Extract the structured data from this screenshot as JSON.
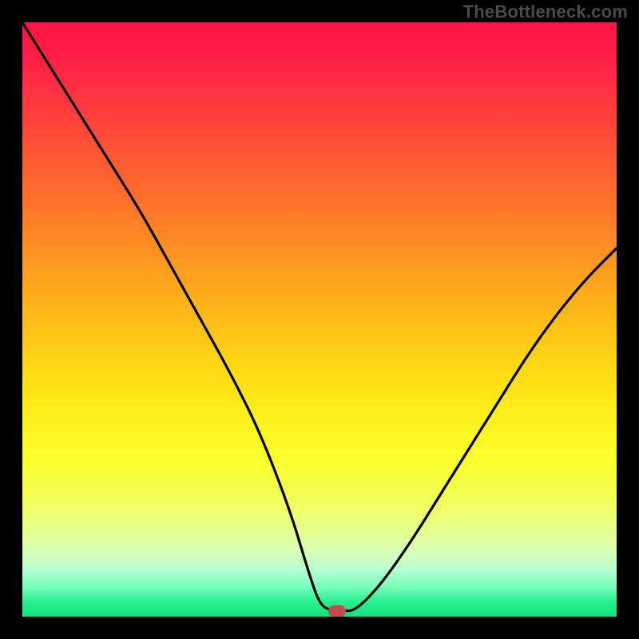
{
  "watermark": "TheBottleneck.com",
  "chart_data": {
    "type": "line",
    "title": "",
    "xlabel": "",
    "ylabel": "",
    "xlim": [
      0,
      100
    ],
    "ylim": [
      0,
      100
    ],
    "grid": false,
    "legend": false,
    "background": "rainbow-vertical-gradient",
    "series": [
      {
        "name": "bottleneck-curve",
        "x": [
          0,
          5,
          10,
          15,
          20,
          25,
          30,
          35,
          40,
          45,
          48,
          50,
          52,
          54,
          56,
          60,
          65,
          70,
          75,
          80,
          85,
          90,
          95,
          100
        ],
        "y": [
          100,
          92,
          84,
          76,
          68,
          59,
          50,
          41,
          31,
          18,
          8,
          2,
          1,
          1,
          1,
          5,
          12,
          20,
          28,
          36,
          44,
          51,
          57,
          62
        ]
      }
    ],
    "marker": {
      "x": 53,
      "y": 1,
      "color": "#c24b4d",
      "shape": "rounded-rect"
    },
    "gradient_stops": [
      {
        "pos": 0.0,
        "color": "#ff1446"
      },
      {
        "pos": 0.28,
        "color": "#ff6a2d"
      },
      {
        "pos": 0.57,
        "color": "#ffd514"
      },
      {
        "pos": 0.8,
        "color": "#f2ff56"
      },
      {
        "pos": 0.95,
        "color": "#7affba"
      },
      {
        "pos": 1.0,
        "color": "#17e07e"
      }
    ]
  }
}
